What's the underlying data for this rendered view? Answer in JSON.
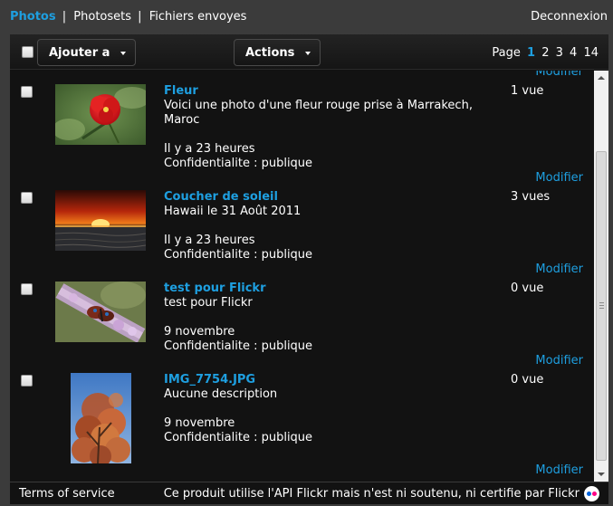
{
  "nav": {
    "tabs": [
      "Photos",
      "Photosets",
      "Fichiers envoyes"
    ],
    "separator": "|",
    "logout": "Deconnexion"
  },
  "toolbar": {
    "add_label": "Ajouter a",
    "actions_label": "Actions",
    "page_label": "Page",
    "pages": [
      "1",
      "2",
      "3",
      "4",
      "14"
    ],
    "current_page": "1"
  },
  "photos": [
    {
      "title": "Fleur",
      "description": "Voici une photo d'une fleur rouge prise à Marrakech, Maroc",
      "date": "Il y a 23 heures",
      "privacy": "Confidentialite : publique",
      "views": "1 vue"
    },
    {
      "title": "Coucher de soleil",
      "description": "Hawaii le 31 Août 2011",
      "date": "Il y a 23 heures",
      "privacy": "Confidentialite : publique",
      "views": "3 vues"
    },
    {
      "title": "test pour Flickr",
      "description": "test pour Flickr",
      "date": "9 novembre",
      "privacy": "Confidentialite : publique",
      "views": "0 vue"
    },
    {
      "title": "IMG_7754.JPG",
      "description": "Aucune description",
      "date": "9 novembre",
      "privacy": "Confidentialite : publique",
      "views": "0 vue"
    }
  ],
  "modify_label": "Modifier",
  "footer": {
    "terms": "Terms of service",
    "disclaimer": "Ce produit utilise l'API Flickr mais n'est ni soutenu, ni certifie par Flickr"
  },
  "colors": {
    "accent": "#1e9fe0",
    "background": "#3b3b3b",
    "panel": "#121212"
  }
}
